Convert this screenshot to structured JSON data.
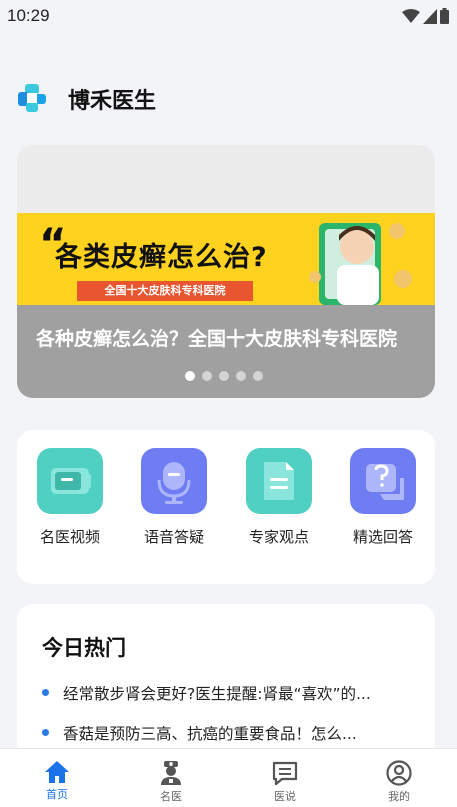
{
  "status_bar": {
    "time": "10:29"
  },
  "header": {
    "title": "博禾医生"
  },
  "banner": {
    "art_headline": "各类皮癣怎么治?",
    "art_strip": "全国十大皮肤科专科医院",
    "caption": "各种皮癣怎么治？全国十大皮肤科专科医院",
    "slide_count": 5,
    "active_slide": 1
  },
  "quick_actions": [
    {
      "label": "名医视频",
      "icon": "video-icon",
      "color": "#4fd0c2"
    },
    {
      "label": "语音答疑",
      "icon": "microphone-icon",
      "color": "#6f7df3"
    },
    {
      "label": "专家观点",
      "icon": "document-icon",
      "color": "#4fd0c2"
    },
    {
      "label": "精选回答",
      "icon": "question-chat-icon",
      "color": "#6f7df3"
    }
  ],
  "hot": {
    "title": "今日热门",
    "items": [
      "经常散步肾会更好?医生提醒:肾最“喜欢”的...",
      "香菇是预防三高、抗癌的重要食品！怎么..."
    ]
  },
  "tabbar": {
    "items": [
      {
        "label": "首页",
        "icon": "home-icon",
        "active": true
      },
      {
        "label": "名医",
        "icon": "doctor-icon",
        "active": false
      },
      {
        "label": "医说",
        "icon": "message-icon",
        "active": false
      },
      {
        "label": "我的",
        "icon": "profile-icon",
        "active": false
      }
    ]
  },
  "colors": {
    "accent": "#1a73e8",
    "bullet": "#2a7be4",
    "teal": "#4fd0c2",
    "indigo": "#6f7df3"
  }
}
